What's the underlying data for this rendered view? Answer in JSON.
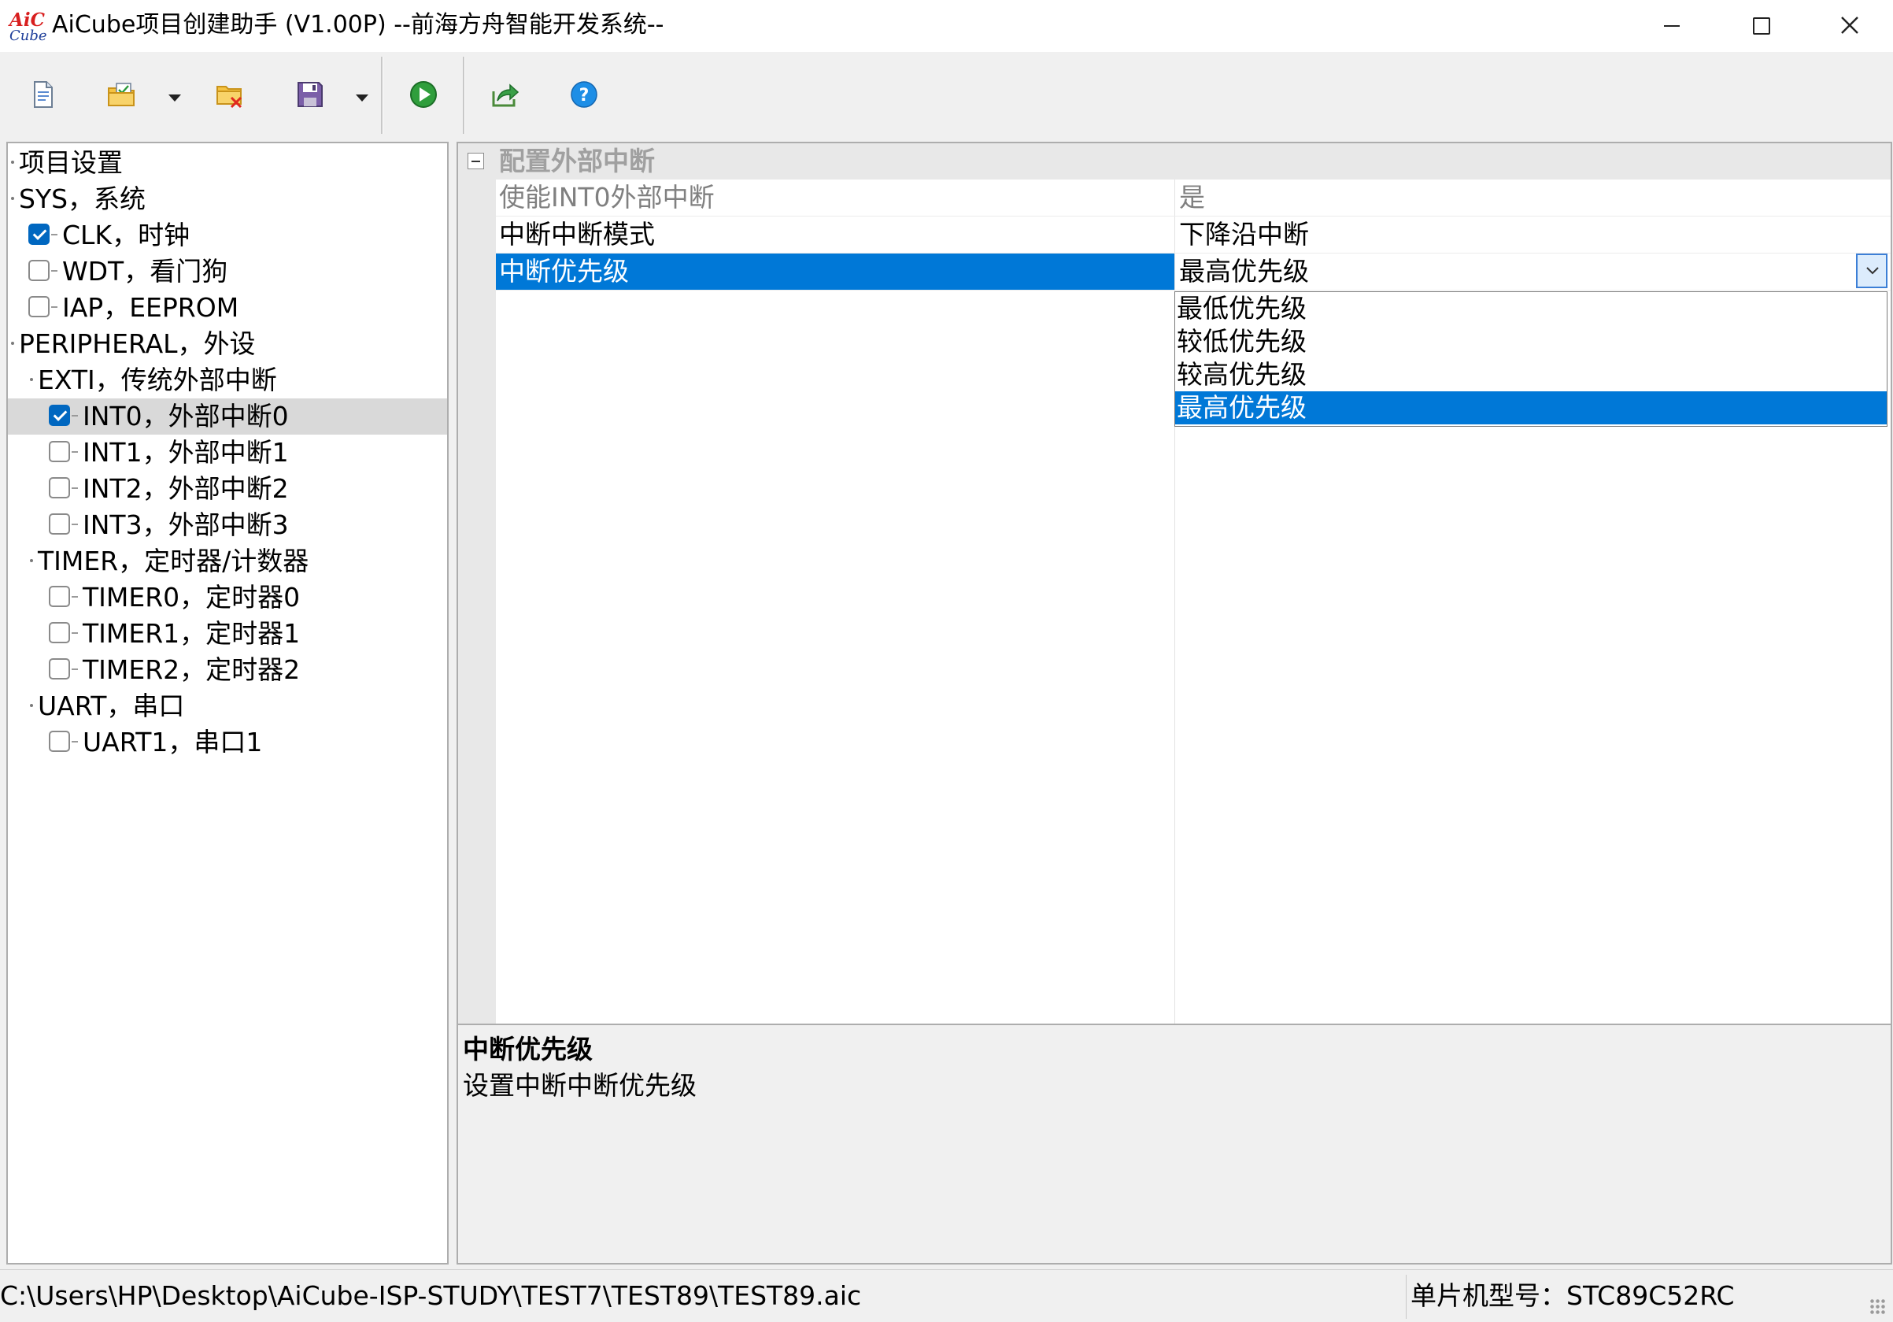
{
  "window": {
    "title": "AiCube项目创建助手 (V1.00P) --前海方舟智能开发系统--",
    "logo_line1": "AiC",
    "logo_line2": "Cube"
  },
  "toolbar": {
    "icons": [
      "new-document-icon",
      "open-project-icon",
      "dropdown-arrow-icon",
      "close-project-icon",
      "save-icon",
      "dropdown-arrow-icon",
      "run-icon",
      "export-icon",
      "help-icon"
    ]
  },
  "tree": {
    "items": [
      {
        "label": "项目设置",
        "level": 0,
        "checkbox": false
      },
      {
        "label": "SYS，系统",
        "level": 0,
        "checkbox": false
      },
      {
        "label": "CLK，时钟",
        "level": 1,
        "checkbox": true,
        "checked": true
      },
      {
        "label": "WDT，看门狗",
        "level": 1,
        "checkbox": true,
        "checked": false
      },
      {
        "label": "IAP，EEPROM",
        "level": 1,
        "checkbox": true,
        "checked": false
      },
      {
        "label": "PERIPHERAL，外设",
        "level": 0,
        "checkbox": false
      },
      {
        "label": "EXTI，传统外部中断",
        "level": 1,
        "checkbox": false
      },
      {
        "label": "INT0，外部中断0",
        "level": 2,
        "checkbox": true,
        "checked": true,
        "selected": true
      },
      {
        "label": "INT1，外部中断1",
        "level": 2,
        "checkbox": true,
        "checked": false
      },
      {
        "label": "INT2，外部中断2",
        "level": 2,
        "checkbox": true,
        "checked": false
      },
      {
        "label": "INT3，外部中断3",
        "level": 2,
        "checkbox": true,
        "checked": false
      },
      {
        "label": "TIMER，定时器/计数器",
        "level": 1,
        "checkbox": false
      },
      {
        "label": "TIMER0，定时器0",
        "level": 2,
        "checkbox": true,
        "checked": false
      },
      {
        "label": "TIMER1，定时器1",
        "level": 2,
        "checkbox": true,
        "checked": false
      },
      {
        "label": "TIMER2，定时器2",
        "level": 2,
        "checkbox": true,
        "checked": false
      },
      {
        "label": "UART，串口",
        "level": 1,
        "checkbox": false
      },
      {
        "label": "UART1，串口1",
        "level": 2,
        "checkbox": true,
        "checked": false
      }
    ]
  },
  "property_grid": {
    "category": "配置外部中断",
    "rows": [
      {
        "name": "使能INT0外部中断",
        "value": "是",
        "disabled": true
      },
      {
        "name": "中断中断模式",
        "value": "下降沿中断"
      },
      {
        "name": "中断优先级",
        "value": "最高优先级",
        "selected": true
      }
    ],
    "dropdown_options": [
      "最低优先级",
      "较低优先级",
      "较高优先级",
      "最高优先级"
    ],
    "dropdown_selected": "最高优先级"
  },
  "description": {
    "title": "中断优先级",
    "text": "设置中断中断优先级"
  },
  "status": {
    "path": "C:\\Users\\HP\\Desktop\\AiCube-ISP-STUDY\\TEST7\\TEST89\\TEST89.aic",
    "mcu": "单片机型号：STC89C52RC"
  },
  "colors": {
    "selection": "#0078d7",
    "checkbox_checked": "#0067c0",
    "window_bg": "#f0f0f0"
  }
}
